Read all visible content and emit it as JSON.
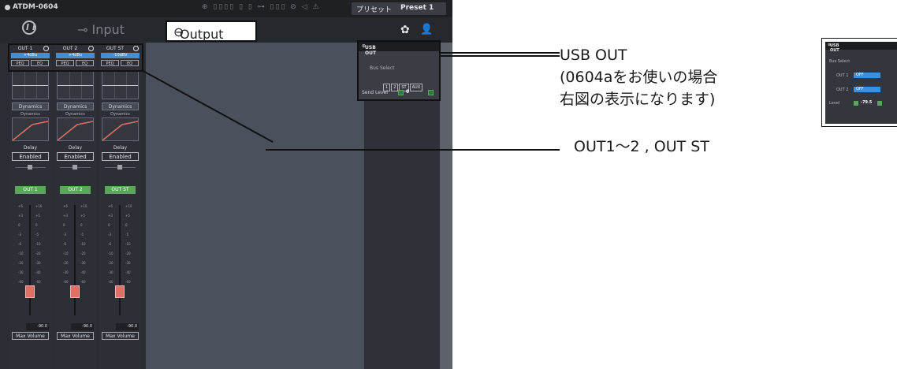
{
  "app": {
    "device_name": "ATDM-0604",
    "preset_label": "プリセット",
    "preset_value": "Preset 1",
    "titlebar_icons": "⊕ ▯▯▯▯ ▯ ▯ ⊶ ▯▯▯  ⊘ ◁ ⚠",
    "tabs": {
      "input": "Input",
      "output": "Output"
    }
  },
  "channels": [
    {
      "name": "OUT 1",
      "level_select": "+4dBu",
      "peq": "PEQ",
      "eq": "EQ",
      "dynamics_button": "Dynamics",
      "dynamics_label": "Dynamics",
      "delay_label": "Delay",
      "delay_state": "Enabled",
      "badge": "OUT 1",
      "volume": "-90.0",
      "max_volume": "Max Volume"
    },
    {
      "name": "OUT 2",
      "level_select": "+4dBu",
      "peq": "PEQ",
      "eq": "EQ",
      "dynamics_button": "Dynamics",
      "dynamics_label": "Dynamics",
      "delay_label": "Delay",
      "delay_state": "Enabled",
      "badge": "OUT 2",
      "volume": "-90.0",
      "max_volume": "Max Volume"
    },
    {
      "name": "OUT ST",
      "level_select": "-10dBV",
      "peq": "PEQ",
      "eq": "EQ",
      "dynamics_button": "Dynamics",
      "dynamics_label": "Dynamics",
      "delay_label": "Delay",
      "delay_state": "Enabled",
      "badge": "OUT ST",
      "volume": "-90.0",
      "max_volume": "Max Volume"
    }
  ],
  "fader_scale": {
    "left": [
      "+6",
      "+3",
      "0",
      "-3",
      "-6",
      "-10",
      "-20",
      "-30",
      "-60"
    ],
    "right": [
      "+10",
      "+5",
      "0",
      "-5",
      "-10",
      "-20",
      "-30",
      "-40",
      "-60"
    ]
  },
  "usb_out": {
    "title": "USB OUT",
    "bus_select": "Bus Select",
    "buttons": [
      "1",
      "2",
      "ST",
      "AUX"
    ],
    "send_level_label": "Send Level",
    "send_level_value": "0"
  },
  "annotations": {
    "usb_line1": "USB OUT",
    "usb_line2": "(0604aをお使いの場合",
    "usb_line3": "右図の表示になります)",
    "out_label": "OUT1～2 , OUT ST"
  },
  "mini_panel": {
    "title": "USB OUT",
    "bus_select": "Bus Select",
    "out1_label": "OUT 1",
    "out1_value": "OFF",
    "out2_label": "OUT 2",
    "out2_value": "OFF",
    "level_label": "Level",
    "level_value": "-79.5"
  }
}
